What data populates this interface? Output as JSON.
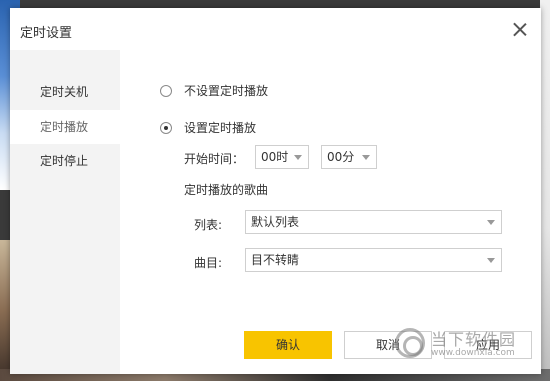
{
  "dialog": {
    "title": "定时设置"
  },
  "sidebar": {
    "items": [
      {
        "label": "定时关机"
      },
      {
        "label": "定时播放"
      },
      {
        "label": "定时停止"
      }
    ]
  },
  "schedule": {
    "option_off": "不设置定时播放",
    "option_on": "设置定时播放",
    "start_time_label": "开始时间：",
    "hour_value": "00时",
    "minute_value": "00分",
    "songs_section_label": "定时播放的歌曲",
    "list_label": "列表:",
    "list_value": "默认列表",
    "track_label": "曲目:",
    "track_value": "目不转睛"
  },
  "buttons": {
    "confirm": "确认",
    "cancel": "取消",
    "apply": "应用"
  },
  "watermark": {
    "text": "当下软件园",
    "url": "www.downxia.com"
  },
  "colors": {
    "accent": "#f8c400",
    "sidebar_bg": "#f3f3f3"
  }
}
